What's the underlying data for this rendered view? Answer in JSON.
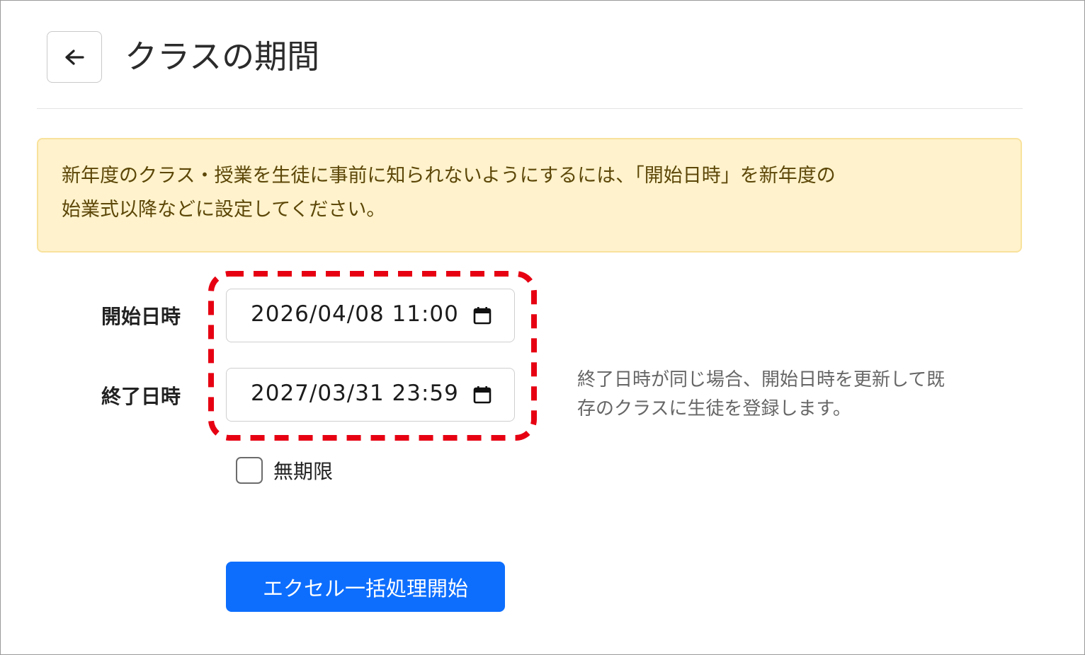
{
  "header": {
    "title": "クラスの期間",
    "back_icon": "arrow-left-icon"
  },
  "alert": {
    "line1": "新年度のクラス・授業を生徒に事前に知られないようにするには、「開始日時」を新年度の",
    "line2": "始業式以降などに設定してください。"
  },
  "form": {
    "start_label": "開始日時",
    "start_value": "2026/04/08 11:00",
    "end_label": "終了日時",
    "end_value": "2027/03/31 23:59",
    "calendar_icon": "calendar-icon",
    "side_note_line1": "終了日時が同じ場合、開始日時を更新して既",
    "side_note_line2": "存のクラスに生徒を登録します。",
    "unlimited_label": "無期限",
    "unlimited_checked": false,
    "submit_label": "エクセル一括処理開始"
  },
  "colors": {
    "primary": "#0d6efd",
    "alert_bg": "#fff2cc",
    "alert_text": "#5c4708",
    "highlight": "#e60012"
  }
}
